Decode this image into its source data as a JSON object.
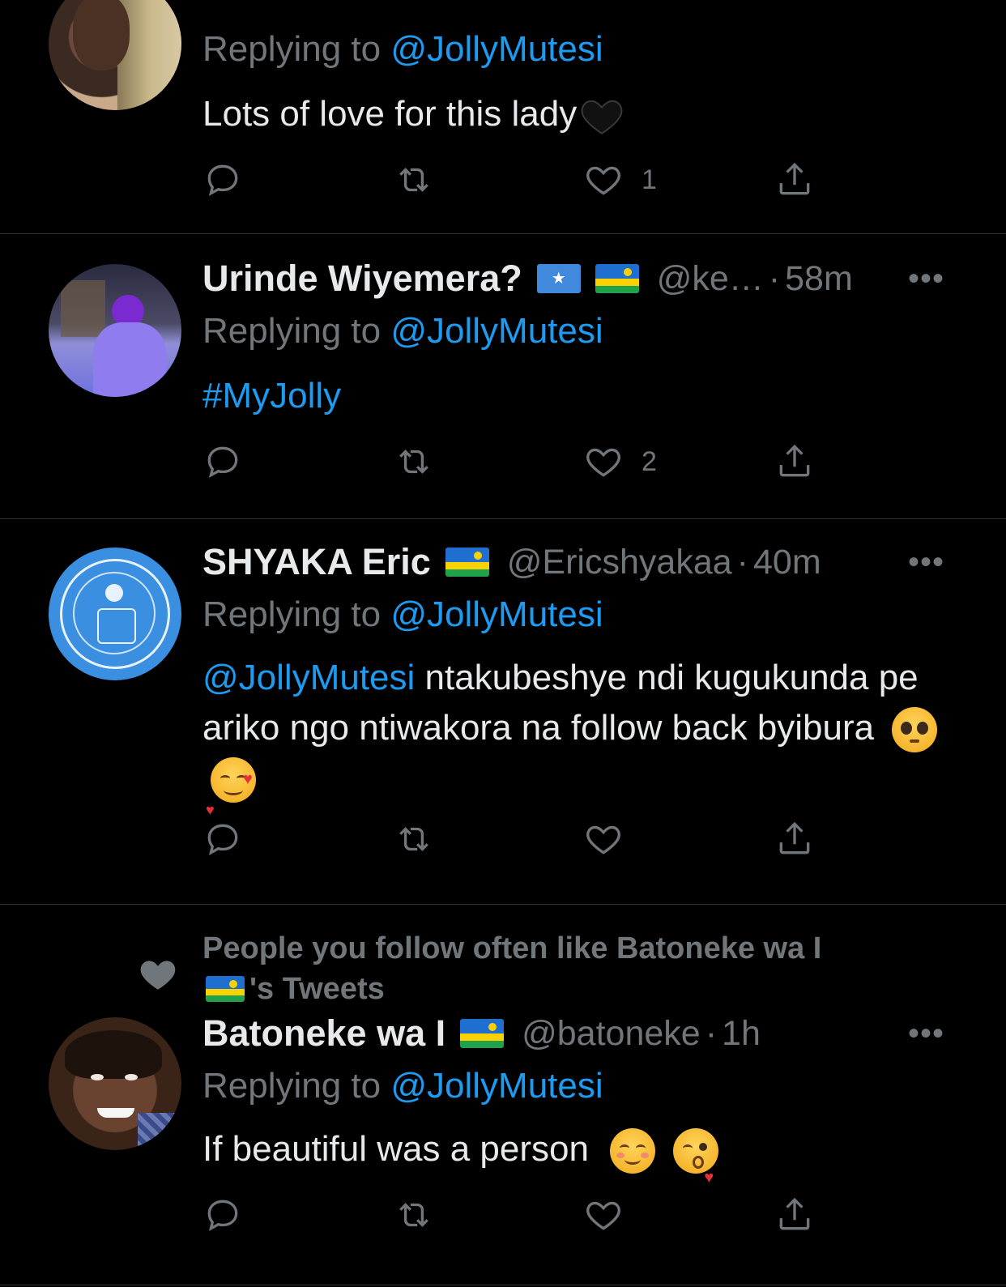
{
  "tweets": [
    {
      "replying_prefix": "Replying to ",
      "replying_to": "@JollyMutesi",
      "text": "Lots of love for this lady",
      "text_emoji": "black-heart",
      "likes": "1"
    },
    {
      "name": "Urinde Wiyemera?",
      "flags": [
        "somalia-flag",
        "rwanda-flag"
      ],
      "handle": "@ke…",
      "dot": "·",
      "time": "58m",
      "replying_prefix": "Replying to ",
      "replying_to": "@JollyMutesi",
      "text": "#MyJolly",
      "likes": "2"
    },
    {
      "name": "SHYAKA Eric",
      "flags": [
        "rwanda-flag"
      ],
      "handle": "@Ericshyakaa",
      "dot": "·",
      "time": "40m",
      "replying_prefix": "Replying to ",
      "replying_to": "@JollyMutesi",
      "text_mention": "@JollyMutesi",
      "text": " ntakubeshye ndi kugukunda pe ariko ngo ntiwakora na follow back byibura",
      "text_emojis": [
        "pleading-face-emoji",
        "smiling-face-with-hearts-emoji"
      ]
    },
    {
      "social_context": "People you follow often like Batoneke wa I",
      "social_context_suffix": "'s Tweets",
      "name": "Batoneke wa I",
      "flags": [
        "rwanda-flag"
      ],
      "handle": "@batoneke",
      "dot": "·",
      "time": "1h",
      "replying_prefix": "Replying to ",
      "replying_to": "@JollyMutesi",
      "text": "If beautiful was a person",
      "text_emojis": [
        "smiling-face-emoji",
        "kissing-face-emoji"
      ]
    }
  ],
  "more_label": "•••",
  "colors": {
    "link": "#1d9bf0",
    "muted": "#71767b",
    "text": "#e7e9ea",
    "background": "#000000",
    "divider": "#2f3336"
  }
}
